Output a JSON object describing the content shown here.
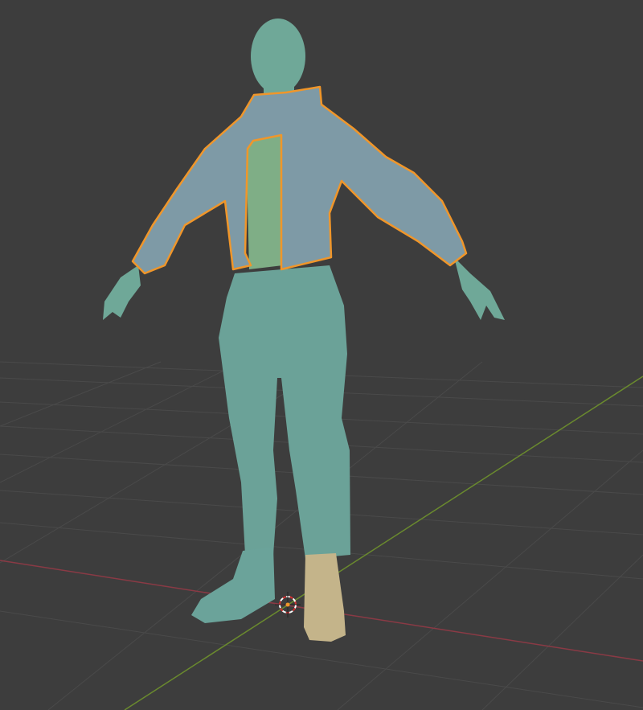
{
  "viewport": {
    "mode": "3d-viewport",
    "background_color": "#3d3d3d",
    "grid_color": "#4a4a4a",
    "x_axis_color": "#8a3a45",
    "y_axis_color": "#6a8a2e",
    "selection_outline_color": "#f0962a"
  },
  "scene": {
    "objects": [
      {
        "name": "body",
        "color": "#6fa898",
        "selected": false
      },
      {
        "name": "jacket",
        "color": "#7e9aa6",
        "selected": true
      },
      {
        "name": "shirt",
        "color": "#7fae86",
        "selected": false
      },
      {
        "name": "boot",
        "color": "#c4b48a",
        "selected": false
      }
    ],
    "cursor_icon": "3d-cursor-icon"
  }
}
